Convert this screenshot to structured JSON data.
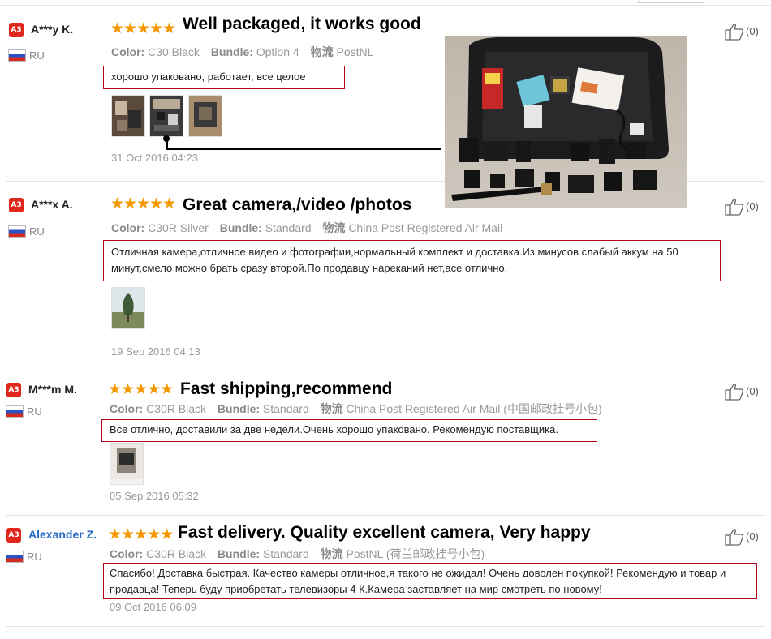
{
  "reviews": [
    {
      "badge": "A3",
      "user": "A***y K.",
      "country": "RU",
      "stars": "★★★★★",
      "headline": "Well packaged, it works good",
      "color_label": "Color:",
      "color": "C30 Black",
      "bundle_label": "Bundle:",
      "bundle": "Option 4",
      "shipping_label": "物流",
      "shipping": "PostNL",
      "text": "хорошо упаковано, работает, все целое",
      "date": "31 Oct 2016 04:23",
      "likes": "(0)"
    },
    {
      "badge": "A3",
      "user": "A***x A.",
      "country": "RU",
      "stars": "★★★★★",
      "headline": "Great camera,/video /photos",
      "color_label": "Color:",
      "color": "C30R Silver",
      "bundle_label": "Bundle:",
      "bundle": "Standard",
      "shipping_label": "物流",
      "shipping": "China Post Registered Air Mail",
      "text": "Отличная камера,отличное видео и фотографии,нормальный комплект и доставка.Из минусов слабый аккум на 50 минут,смело можно брать сразу второй.По продавцу нареканий нет,асе отлично.",
      "date": "19 Sep 2016 04:13",
      "likes": "(0)"
    },
    {
      "badge": "A3",
      "user": "M***m M.",
      "country": "RU",
      "stars": "★★★★★",
      "headline": "Fast shipping,recommend",
      "color_label": "Color:",
      "color": "C30R Black",
      "bundle_label": "Bundle:",
      "bundle": "Standard",
      "shipping_label": "物流",
      "shipping": "China Post Registered Air Mail (中国邮政挂号小包)",
      "text": "Все отлично, доставили за две недели.Очень хорошо упаковано. Рекомендую поставщика.",
      "date": "05 Sep 2016 05:32",
      "likes": "(0)"
    },
    {
      "badge": "A3",
      "user": "Alexander Z.",
      "country": "RU",
      "stars": "★★★★★",
      "headline": "Fast delivery. Quality excellent camera, Very happy",
      "color_label": "Color:",
      "color": "C30R Black",
      "bundle_label": "Bundle:",
      "bundle": "Standard",
      "shipping_label": "物流",
      "shipping": "PostNL (荷兰邮政挂号小包)",
      "text": "Спасибо! Доставка быстрая. Качество камеры отличное,я такого не ожидал! Очень доволен покупкой! Рекомендую и товар и продавца! Теперь буду приобретать телевизоры 4 К.Камера заставляет на мир смотреть по новому!",
      "date": "09 Oct 2016 06:09",
      "likes": "(0)"
    }
  ],
  "icons": {
    "like": "thumbs-up-icon",
    "flag": "russia-flag-icon"
  },
  "colors": {
    "star": "#f39800",
    "badge": "#e1261c",
    "highlight_border": "#b3001b",
    "user_link": "#2468c4"
  }
}
